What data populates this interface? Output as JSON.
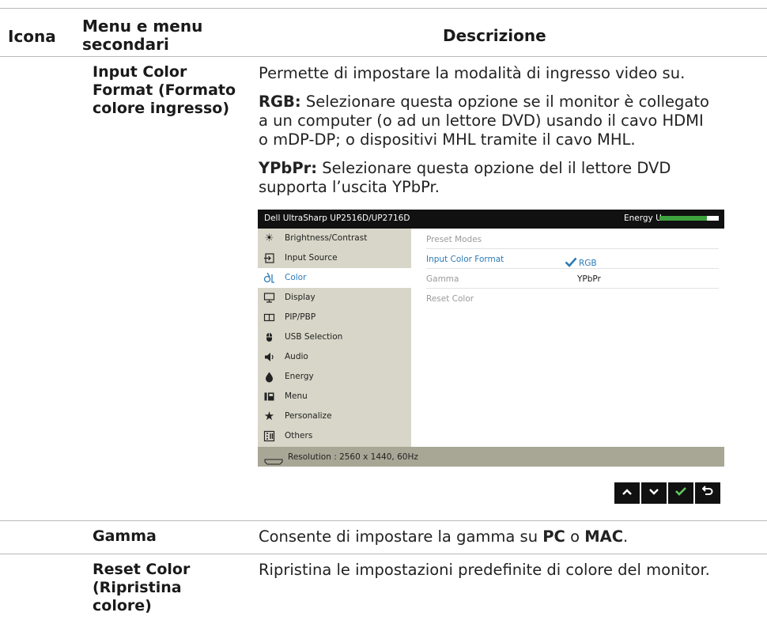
{
  "header": {
    "col_icon": "Icona",
    "col_menu_line1": "Menu e menu",
    "col_menu_line2": "secondari",
    "col_desc": "Descrizione"
  },
  "rows": {
    "input_color": {
      "title_line1": "Input Color",
      "title_line2": "Format (Formato",
      "title_line3": "colore ingresso)",
      "intro": "Permette di impostare la modalità di ingresso video su.",
      "rgb_label": "RGB:",
      "rgb_line1": " Selezionare questa opzione se il monitor è collegato",
      "rgb_line2": "a un computer (o ad un lettore DVD) usando il cavo HDMI",
      "rgb_line3": "o mDP-DP; o dispositivi MHL tramite il cavo MHL.",
      "ypbpr_label": "YPbPr:",
      "ypbpr_line1": " Selezionare questa opzione del il lettore DVD",
      "ypbpr_line2": "supporta l’uscita YPbPr."
    },
    "gamma": {
      "title": "Gamma",
      "desc_pre": "Consente di impostare la gamma su ",
      "pc": "PC",
      "mid": " o ",
      "mac": "MAC",
      "end": "."
    },
    "reset": {
      "title_line1": "Reset Color",
      "title_line2": "(Ripristina",
      "title_line3": "colore)",
      "desc": "Ripristina le impostazioni predefinite di colore del monitor."
    }
  },
  "osd": {
    "title": "Dell UltraSharp UP2516D/UP2716D",
    "energy_label": "Energy Use",
    "energy_level": 0.8,
    "menu": [
      {
        "label": "Brightness/Contrast",
        "icon": "sun-icon"
      },
      {
        "label": "Input Source",
        "icon": "input-source-icon"
      },
      {
        "label": "Color",
        "icon": "color-icon"
      },
      {
        "label": "Display",
        "icon": "display-icon"
      },
      {
        "label": "PIP/PBP",
        "icon": "pip-icon"
      },
      {
        "label": "USB Selection",
        "icon": "usb-icon"
      },
      {
        "label": "Audio",
        "icon": "speaker-icon"
      },
      {
        "label": "Energy",
        "icon": "energy-icon"
      },
      {
        "label": "Menu",
        "icon": "menu-icon"
      },
      {
        "label": "Personalize",
        "icon": "star-icon"
      },
      {
        "label": "Others",
        "icon": "others-icon"
      }
    ],
    "active_menu": "Color",
    "submenu": [
      "Preset Modes",
      "Input Color Format",
      "Gamma",
      "Reset Color"
    ],
    "active_submenu": "Input Color Format",
    "options": {
      "rgb": "RGB",
      "ypbpr": "YPbPr"
    },
    "selected_option": "RGB",
    "resolution": "Resolution : 2560 x 1440, 60Hz",
    "colors": {
      "accent": "#2a7ab8",
      "menu_bg": "#d7d6c8",
      "bar": "#3ea33e"
    }
  },
  "buttons": [
    {
      "name": "up-button",
      "icon": "chevron-up-icon"
    },
    {
      "name": "down-button",
      "icon": "chevron-down-icon"
    },
    {
      "name": "ok-button",
      "icon": "check-icon"
    },
    {
      "name": "back-button",
      "icon": "back-icon"
    }
  ]
}
